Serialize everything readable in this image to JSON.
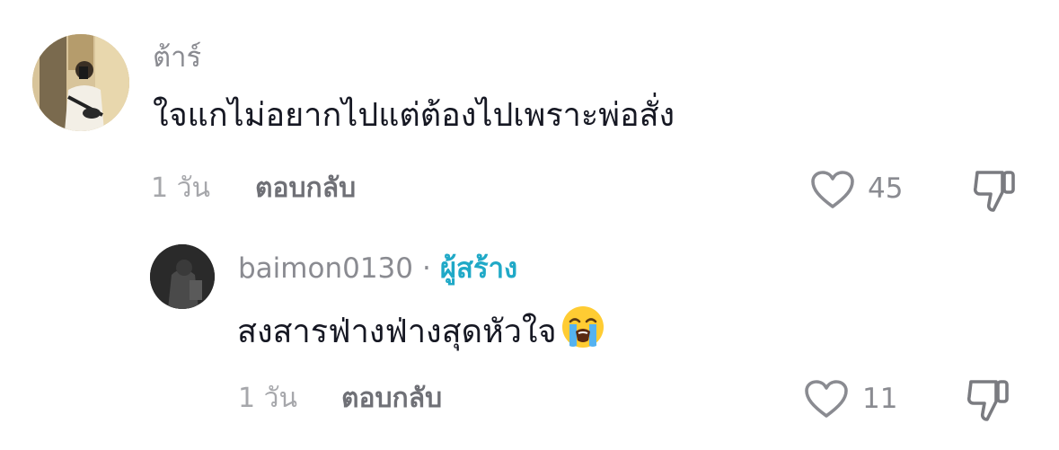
{
  "comments": [
    {
      "username": "ต้าร์",
      "text": "ใจแกไม่อยากไปแต่ต้องไปเพราะพ่อสั่ง",
      "time": "1 วัน",
      "reply_label": "ตอบกลับ",
      "likes": "45"
    }
  ],
  "replies": [
    {
      "username": "baimon0130",
      "separator": "·",
      "creator_label": "ผู้สร้าง",
      "text": "สงสารฟ่างฟ่างสุดหัวใจ",
      "emoji": "loudly-crying-face",
      "time": "1 วัน",
      "reply_label": "ตอบกลับ",
      "likes": "11"
    }
  ],
  "colors": {
    "text_primary": "#161823",
    "text_secondary": "#8a8b91",
    "creator_accent": "#20a9c7"
  },
  "icons": {
    "like": "heart-outline-icon",
    "dislike": "thumbs-down-outline-icon"
  }
}
